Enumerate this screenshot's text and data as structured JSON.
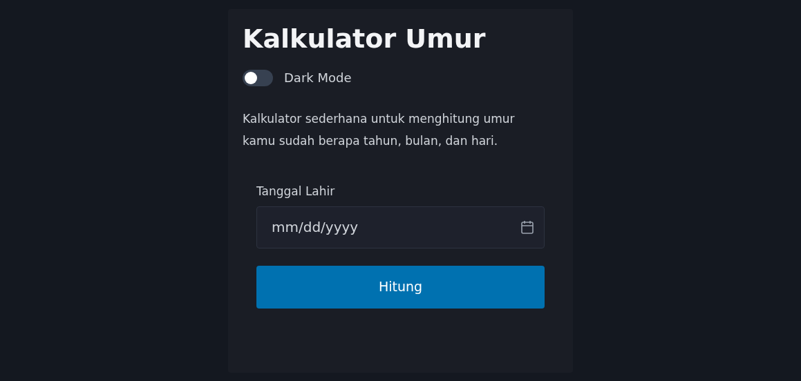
{
  "title": "Kalkulator Umur",
  "dark_mode": {
    "label": "Dark Mode",
    "on": false
  },
  "description": "Kalkulator sederhana untuk menghitung umur kamu sudah berapa tahun, bulan, dan hari.",
  "birth_date": {
    "label": "Tanggal Lahir",
    "placeholder": "mm/dd/yyyy"
  },
  "button": "Hitung"
}
